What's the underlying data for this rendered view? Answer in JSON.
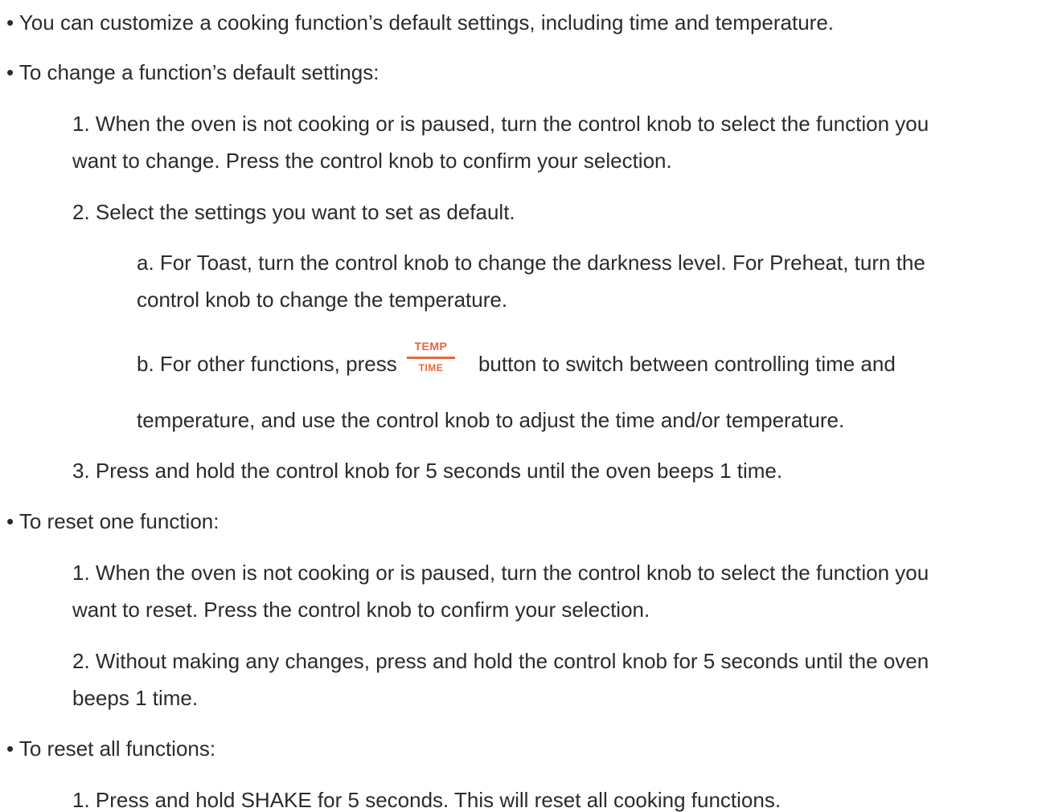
{
  "bullets": {
    "customize": "• You can customize a cooking function’s default settings, including time and temperature.",
    "change_heading": "• To change a function’s default settings:",
    "reset_one_heading": "• To reset one function:",
    "reset_all_heading": "• To reset all functions:"
  },
  "change_steps": {
    "step1_line1": "1. When the oven is not cooking or is paused, turn the control knob to select the function you",
    "step1_line2": "want to change. Press the control knob to confirm your selection.",
    "step2": "2. Select the settings you want to set as default.",
    "step2a_line1": "a. For Toast, turn the control knob to change the darkness level. For Preheat, turn the",
    "step2a_line2": "control knob to change the temperature.",
    "step2b_before": "b. For other functions, press",
    "step2b_after": "button to switch between controlling time and",
    "step2b_line2": "temperature, and use the control knob to adjust the time and/or temperature.",
    "step3": "3. Press and hold the control knob for 5 seconds until the oven beeps 1 time."
  },
  "temp_time_icon": {
    "top": "TEMP",
    "bottom": "TIME",
    "icon": "temp-time-button-icon",
    "color": "#e8643c"
  },
  "reset_one_steps": {
    "step1_line1": "1. When the oven is not cooking or is paused, turn the control knob to select the function you",
    "step1_line2": "want to reset. Press the control knob to confirm your selection.",
    "step2_line1": "2. Without making any changes, press and hold the control knob for 5 seconds until the oven",
    "step2_line2": "beeps 1 time."
  },
  "reset_all_steps": {
    "step1": "1. Press and hold SHAKE for 5 seconds. This will reset all cooking functions."
  }
}
